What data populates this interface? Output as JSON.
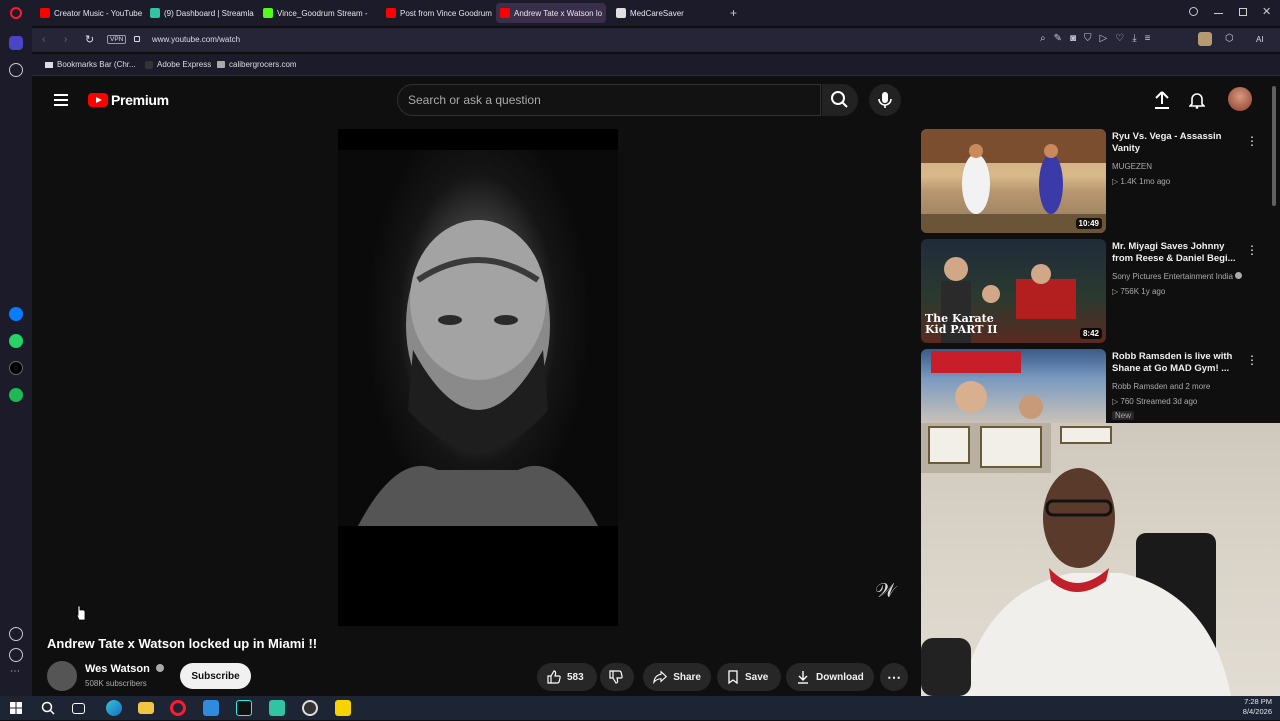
{
  "browser": {
    "tabs": [
      {
        "label": "Creator Music - YouTube S",
        "color": "#ff0000"
      },
      {
        "label": "(9) Dashboard | Streamlab",
        "color": "#31c3a2"
      },
      {
        "label": "Vince_Goodrum Stream - ",
        "color": "#53fc18"
      },
      {
        "label": "Post from Vince Goodrum",
        "color": "#ff0000"
      },
      {
        "label": "Andrew Tate x Watson lo",
        "color": "#ff0000"
      },
      {
        "label": "MedCareSaver",
        "color": "#e0e0e0"
      }
    ],
    "vpn_label": "VPN",
    "url": "www.youtube.com/watch",
    "ai_label": "AI",
    "bookmarks": [
      {
        "label": "Bookmarks Bar (Chr..."
      },
      {
        "label": "Adobe Express"
      },
      {
        "label": "calibergrocers.com"
      }
    ]
  },
  "youtube": {
    "logo_text": "Premium",
    "search_placeholder": "Search or ask a question",
    "video": {
      "title": "Andrew Tate x Watson locked up in Miami !!",
      "channel": "Wes Watson",
      "subscribers": "508K subscribers",
      "subscribe_label": "Subscribe",
      "likes": "583",
      "share_label": "Share",
      "save_label": "Save",
      "download_label": "Download"
    },
    "recommendations": [
      {
        "title": "Ryu Vs. Vega - Assassin Vanity",
        "channel": "MUGEZEN",
        "meta": "1.4K  1mo ago",
        "duration": "10:49",
        "play_glyph": "▷"
      },
      {
        "title": "Mr. Miyagi Saves Johnny from Reese & Daniel Begi...",
        "channel": "Sony Pictures Entertainment India",
        "meta": "756K  1y ago",
        "duration": "8:42",
        "thumb_text": "The Karate Kid PART II",
        "play_glyph": "▷"
      },
      {
        "title": "Robb Ramsden is live with Shane at Go MAD Gym! ...",
        "channel": "Robb Ramsden and 2 more",
        "meta": "760  Streamed 3d ago",
        "badge": "New",
        "play_glyph": "▷"
      }
    ]
  },
  "taskbar": {
    "time": "7:28 PM",
    "date": "8/4/2026"
  }
}
